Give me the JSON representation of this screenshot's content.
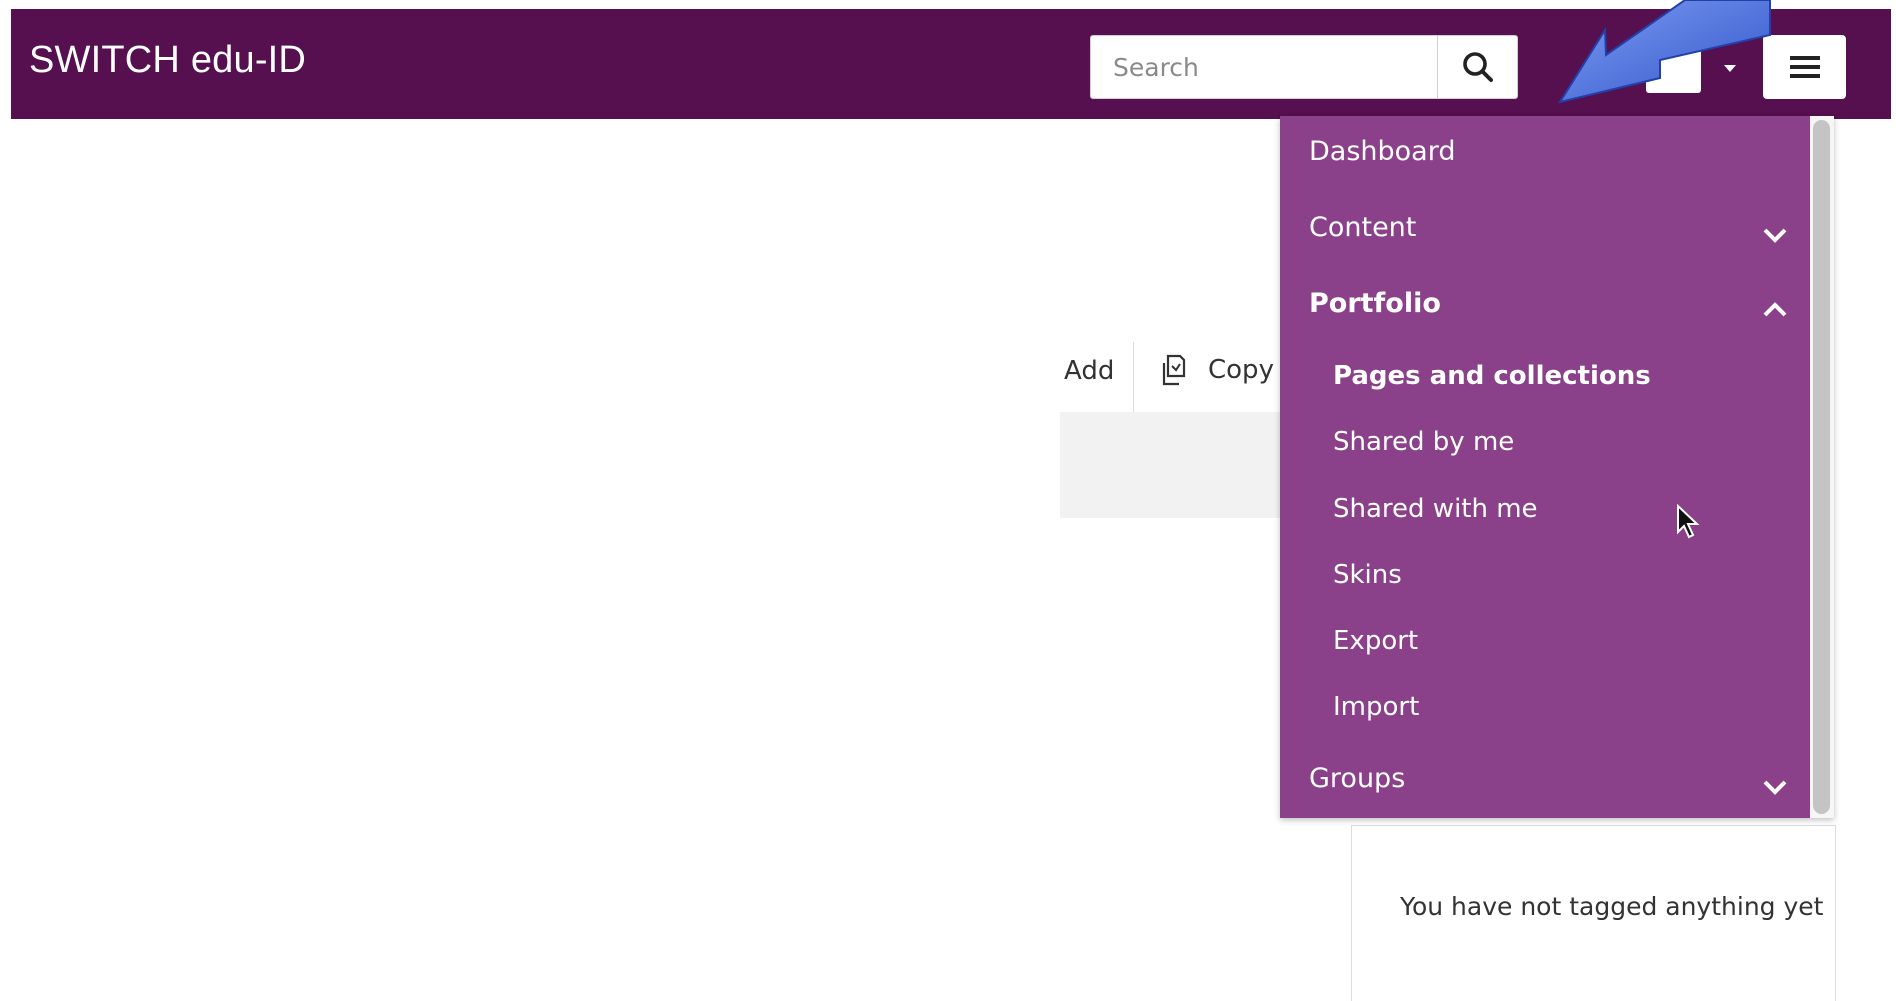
{
  "header": {
    "brand": "SWITCH edu-ID",
    "search_placeholder": "Search",
    "search_icon": "search-icon",
    "menu_icon": "hamburger-icon",
    "background": "#560f4f"
  },
  "toolbar": {
    "add_label": "Add",
    "copy_label": "Copy",
    "copy_icon": "copy-icon"
  },
  "nav": {
    "background": "#8a418a",
    "items": [
      {
        "label": "Dashboard"
      },
      {
        "label": "Content",
        "icon": "chevron-down-icon"
      },
      {
        "label": "Portfolio",
        "icon": "chevron-up-icon",
        "expanded": true
      },
      {
        "label": "Groups",
        "icon": "chevron-down-icon"
      }
    ],
    "portfolio_items": [
      {
        "label": "Pages and collections",
        "active": true
      },
      {
        "label": "Shared by me"
      },
      {
        "label": "Shared with me"
      },
      {
        "label": "Skins"
      },
      {
        "label": "Export"
      },
      {
        "label": "Import"
      }
    ]
  },
  "tags": {
    "empty_text": "You have not tagged anything yet"
  },
  "annotation": {
    "arrow_icon": "annotation-arrow",
    "color": "#3b5fd6"
  }
}
